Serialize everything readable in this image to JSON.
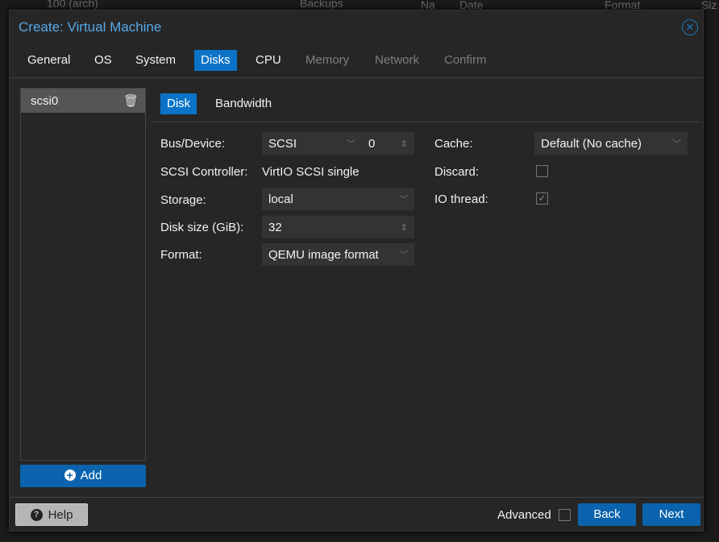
{
  "background": {
    "vm": "100 (arch)",
    "backups": "Backups",
    "col_name": "Na",
    "col_date": "Date",
    "col_format": "Format",
    "col_size": "Siz"
  },
  "dialog": {
    "title": "Create: Virtual Machine",
    "close_icon": "close-circle-icon",
    "tabs": [
      {
        "label": "General",
        "state": "enabled"
      },
      {
        "label": "OS",
        "state": "enabled"
      },
      {
        "label": "System",
        "state": "enabled"
      },
      {
        "label": "Disks",
        "state": "active"
      },
      {
        "label": "CPU",
        "state": "enabled"
      },
      {
        "label": "Memory",
        "state": "disabled"
      },
      {
        "label": "Network",
        "state": "disabled"
      },
      {
        "label": "Confirm",
        "state": "disabled"
      }
    ]
  },
  "disks": {
    "items": [
      {
        "label": "scsi0"
      }
    ],
    "add_label": "Add"
  },
  "subtabs": {
    "disk": "Disk",
    "bandwidth": "Bandwidth"
  },
  "form": {
    "bus_label": "Bus/Device:",
    "bus_value": "SCSI",
    "device_value": "0",
    "controller_label": "SCSI Controller:",
    "controller_value": "VirtIO SCSI single",
    "storage_label": "Storage:",
    "storage_value": "local",
    "size_label": "Disk size (GiB):",
    "size_value": "32",
    "format_label": "Format:",
    "format_value": "QEMU image format",
    "cache_label": "Cache:",
    "cache_value": "Default (No cache)",
    "discard_label": "Discard:",
    "discard_checked": false,
    "iothread_label": "IO thread:",
    "iothread_checked": true
  },
  "footer": {
    "help": "Help",
    "advanced": "Advanced",
    "advanced_checked": false,
    "back": "Back",
    "next": "Next"
  },
  "colors": {
    "accent": "#0a73c7",
    "title": "#57a9e8",
    "button": "#0a63ac"
  }
}
